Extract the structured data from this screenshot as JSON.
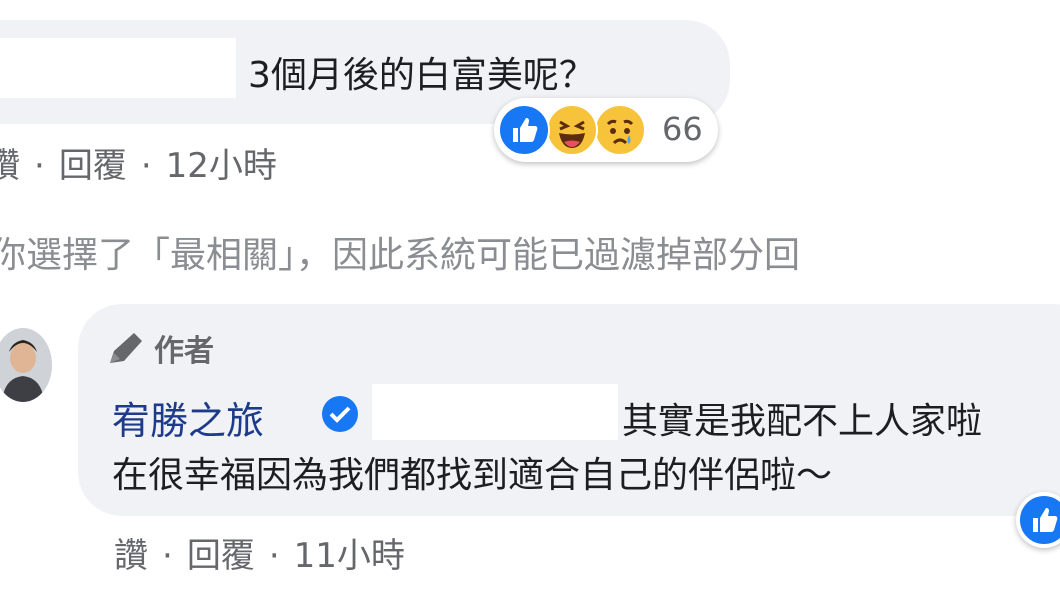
{
  "comment1": {
    "text": "3個月後的白富美呢？",
    "reactions": {
      "icons": [
        "like-icon",
        "haha-icon",
        "sad-icon"
      ],
      "count": "66"
    },
    "actions": {
      "like": "讚",
      "reply": "回覆",
      "time": "12小時",
      "separator": "·"
    }
  },
  "filter_notice": "你選擇了「最相關」，因此系統可能已過濾掉部分回",
  "reply": {
    "badge_label": "作者",
    "author_name": "宥勝之旅",
    "line1": "其實是我配不上人家啦",
    "line2": "在很幸福因為我們都找到適合自己的伴侶啦～",
    "actions": {
      "like": "讚",
      "reply": "回覆",
      "time": "11小時",
      "separator": "·"
    }
  },
  "colors": {
    "bubble": "#f0f2f5",
    "link": "#1d3b8a",
    "like_blue": "#1877f2",
    "secondary_text": "#65676b"
  }
}
